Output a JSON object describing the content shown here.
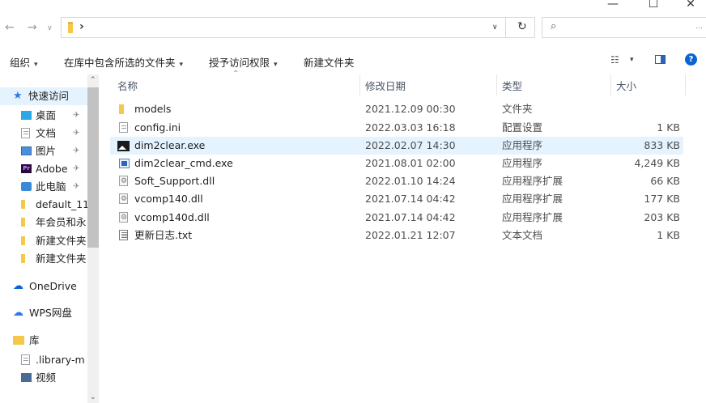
{
  "window": {
    "minimize": "—",
    "maximize": "☐",
    "close": "✕"
  },
  "address": {
    "path_separator": "›",
    "search_placeholder": ""
  },
  "command_bar": {
    "organize": "组织",
    "include_in_library": "在库中包含所选的文件夹",
    "share_with": "授予访问权限",
    "new_folder": "新建文件夹"
  },
  "nav": {
    "quick_access": "快速访问",
    "items": [
      {
        "label": "桌面",
        "pinned": true
      },
      {
        "label": "文档",
        "pinned": true
      },
      {
        "label": "图片",
        "pinned": true
      },
      {
        "label": "Adobe",
        "pinned": true
      },
      {
        "label": "此电脑",
        "pinned": true
      },
      {
        "label": "default_11",
        "pinned": false
      },
      {
        "label": "年会员和永",
        "pinned": false
      },
      {
        "label": "新建文件夹",
        "pinned": false
      },
      {
        "label": "新建文件夹",
        "pinned": false
      }
    ],
    "onedrive": "OneDrive",
    "wps": "WPS网盘",
    "library": "库",
    "library_items": [
      ".library-m",
      "视频"
    ],
    "pin_glyph": "✈"
  },
  "columns": {
    "name": "名称",
    "date": "修改日期",
    "type": "类型",
    "size": "大小"
  },
  "files": [
    {
      "name": "models",
      "date": "2021.12.09 00:30",
      "type": "文件夹",
      "size": "",
      "icon": "folder-icon"
    },
    {
      "name": "config.ini",
      "date": "2022.03.03 16:18",
      "type": "配置设置",
      "size": "1 KB",
      "icon": "settings-file-icon"
    },
    {
      "name": "dim2clear.exe",
      "date": "2022.02.07 14:30",
      "type": "应用程序",
      "size": "833 KB",
      "icon": "image-app-icon",
      "selected": true
    },
    {
      "name": "dim2clear_cmd.exe",
      "date": "2021.08.01 02:00",
      "type": "应用程序",
      "size": "4,249 KB",
      "icon": "application-icon"
    },
    {
      "name": "Soft_Support.dll",
      "date": "2022.01.10 14:24",
      "type": "应用程序扩展",
      "size": "66 KB",
      "icon": "dll-icon"
    },
    {
      "name": "vcomp140.dll",
      "date": "2021.07.14 04:42",
      "type": "应用程序扩展",
      "size": "177 KB",
      "icon": "dll-icon"
    },
    {
      "name": "vcomp140d.dll",
      "date": "2021.07.14 04:42",
      "type": "应用程序扩展",
      "size": "203 KB",
      "icon": "dll-icon"
    },
    {
      "name": "更新日志.txt",
      "date": "2022.01.21 12:07",
      "type": "文本文档",
      "size": "1 KB",
      "icon": "text-file-icon"
    }
  ],
  "colors": {
    "selection": "#e5f3ff",
    "accent": "#0a64d6",
    "folder": "#f5c84c"
  }
}
